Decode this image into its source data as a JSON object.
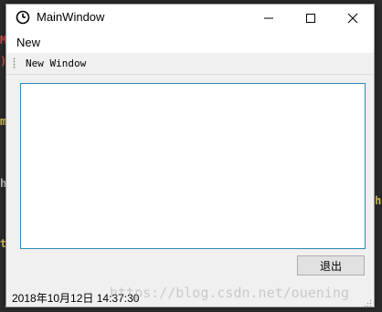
{
  "window": {
    "title": "MainWindow",
    "accent_color": "#2a8ab6"
  },
  "menubar": {
    "items": [
      {
        "label": "New"
      }
    ]
  },
  "toolbar": {
    "actions": [
      {
        "label": "New Window"
      }
    ]
  },
  "central": {
    "text_edit_value": "",
    "quit_button_label": "退出"
  },
  "statusbar": {
    "text": "2018年10月12日 14:37:30"
  },
  "watermark": {
    "text": "https://blog.csdn.net/ouening"
  },
  "icons": {
    "app": "clock-icon",
    "minimize": "minimize-icon",
    "maximize": "maximize-icon",
    "close": "close-icon",
    "size_grip": "size-grip-icon"
  }
}
